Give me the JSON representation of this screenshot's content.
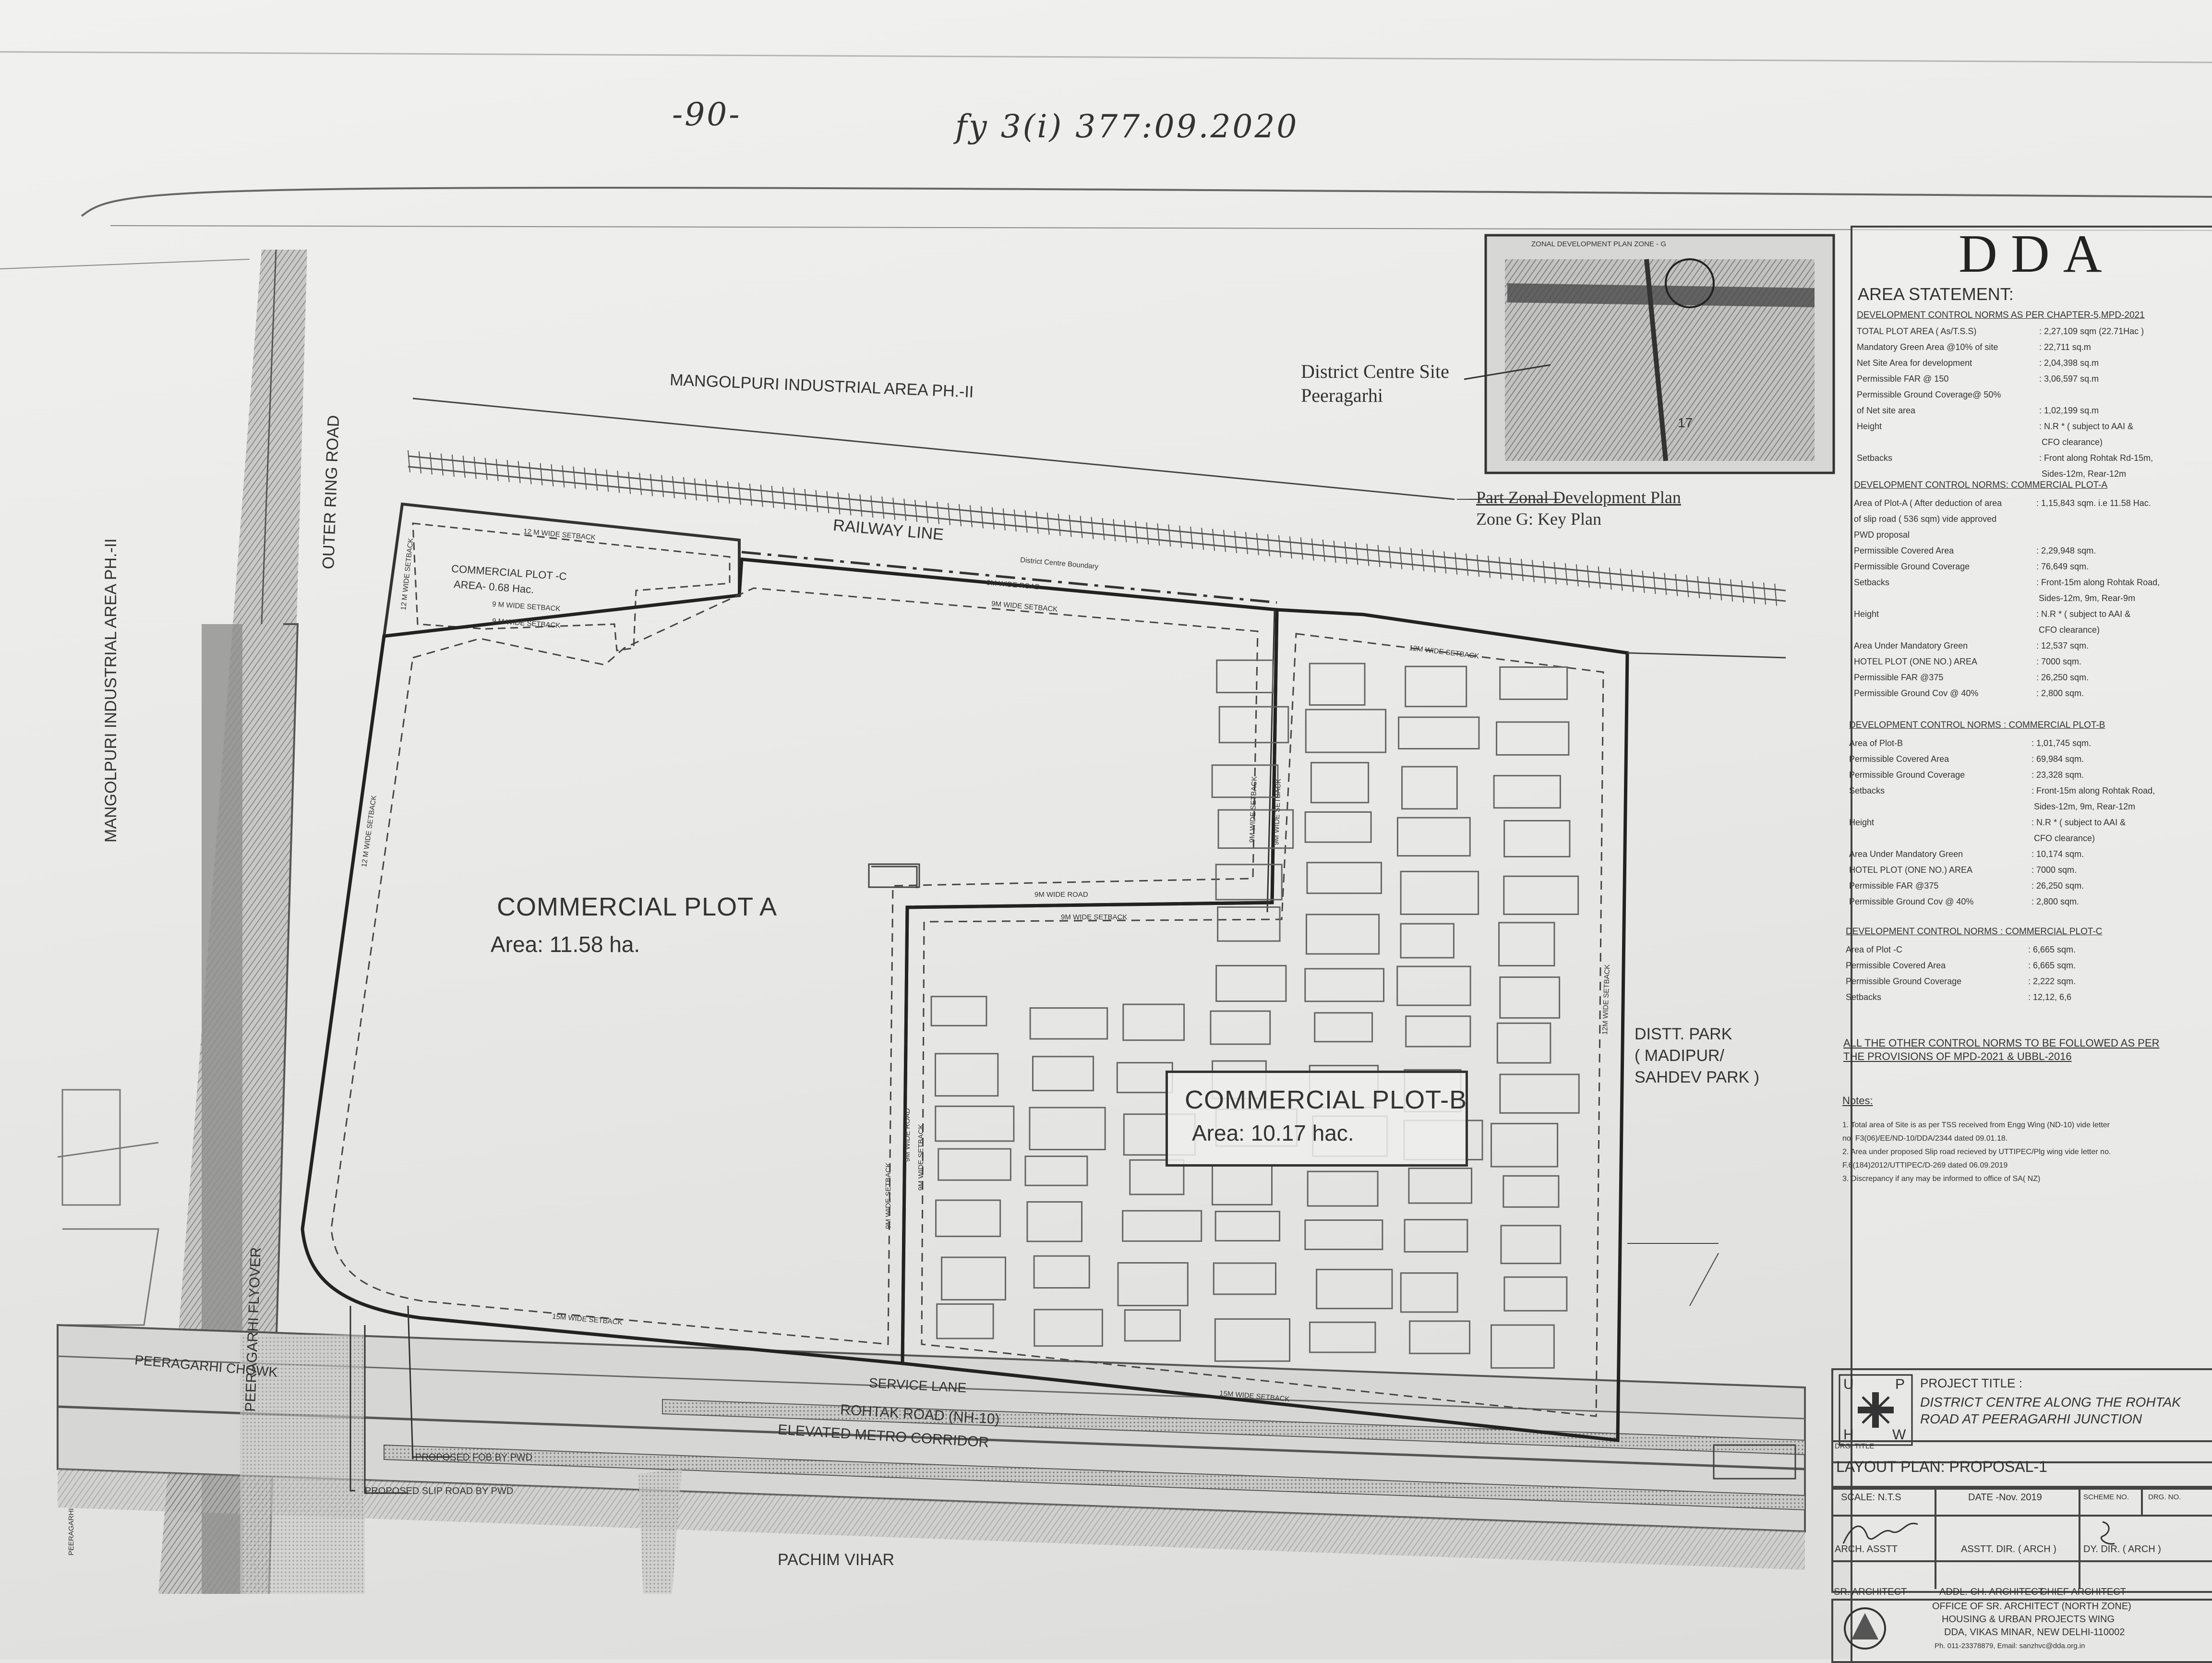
{
  "handwritten_header": {
    "page_mark": "-90-",
    "file_ref": "fy 3(i) 377:09.2020"
  },
  "keyplan": {
    "inset_title": "ZONAL DEVELOPMENT PLAN ZONE - G",
    "site_label_line1": "District Centre Site",
    "site_label_line2": "Peeragarhi",
    "caption_line1": "Part Zonal Development Plan",
    "caption_line2": "Zone G: Key Plan",
    "inset_number": "17"
  },
  "map_labels": {
    "mangolpuri_ph2": "MANGOLPURI INDUSTRIAL AREA PH.-II",
    "mangolpuri_vertical": "MANGOLPURI INDUSTRIAL AREA PH.-II",
    "outer_ring_road": "OUTER RING ROAD",
    "railway_line": "RAILWAY LINE",
    "dc_boundary": "District Centre Boundary",
    "road_9m": "9M WIDE ROAD",
    "peeragarhi_flyover": "PEERAGARHI FLYOVER",
    "peeragarhi_chowk": "PEERAGARHI CHOWK",
    "service_lane": "SERVICE LANE",
    "rohtak_road": "ROHTAK ROAD (NH-10)",
    "metro_corridor": "ELEVATED METRO CORRIDOR",
    "proposed_fob": "PROPOSED FOB BY PWD",
    "proposed_slip": "PROPOSED SLIP ROAD BY PWD",
    "pachim_vihar": "PACHIM VIHAR",
    "distt_park_1": "DISTT. PARK",
    "distt_park_2": "( MADIPUR/",
    "distt_park_3": "SAHDEV PARK )",
    "peeragarhi_small": "PEERAGARHI"
  },
  "setbacks": {
    "s12_top_c": "12 M WIDE SETBACK",
    "s12_left_c": "12 M WIDE SETBACK",
    "s9_c_a": "9 M WIDE SETBACK",
    "s9_c_b": "9 M WIDE SETBACK",
    "s9_top_a": "9M WIDE SETBACK",
    "s12_left_a": "12 M WIDE SETBACK",
    "s9_right_a": "9M WIDE SETBACK",
    "s9_mid_a": "9M WIDE SETBACK",
    "s9_road_b": "9M WIDE ROAD",
    "s9_top_b_inner": "9M WIDE SETBACK",
    "s12_top_b": "12M WIDE SETBACK",
    "s12_right_b": "12M WIDE SETBACK",
    "s15_a": "15M WIDE SETBACK",
    "s15_b": "15M WIDE SETBACK",
    "s9_left_b_1": "9M WIDE SETBACK",
    "s9_left_b_2": "9M WIDE SETBACK",
    "s9_left_b_3": "9M WIDE ROAD"
  },
  "plots": {
    "c_name": "COMMERCIAL PLOT -C",
    "c_area": "AREA- 0.68 Hac.",
    "a_name": "COMMERCIAL PLOT A",
    "a_area": "Area: 11.58 ha.",
    "b_name": "COMMERCIAL PLOT-B",
    "b_area": "Area: 10.17 hac."
  },
  "panel": {
    "logo": "DDA",
    "area_statement": "AREA STATEMENT:",
    "norms_heading": "DEVELOPMENT CONTROL NORMS AS PER CHAPTER-5,MPD-2021",
    "norms_rows": [
      [
        "TOTAL PLOT AREA ( As/T.S.S)",
        ": 2,27,109 sqm (22.71Hac )"
      ],
      [
        "Mandatory Green Area @10% of site",
        ": 22,711 sq.m"
      ],
      [
        "Net Site Area for development",
        ": 2,04,398 sq.m"
      ],
      [
        "Permissible FAR @ 150",
        ": 3,06,597 sq.m"
      ],
      [
        "Permissible Ground Coverage@ 50%",
        ""
      ],
      [
        "of Net site area",
        ": 1,02,199 sq.m"
      ],
      [
        "Height",
        ": N.R * ( subject to AAI &"
      ],
      [
        "",
        "  CFO clearance)"
      ],
      [
        "Setbacks",
        ": Front along Rohtak Rd-15m,"
      ],
      [
        "",
        "  Sides-12m, Rear-12m"
      ]
    ],
    "plot_a_heading": "DEVELOPMENT CONTROL NORMS: COMMERCIAL PLOT-A",
    "plot_a_rows": [
      [
        "Area of Plot-A ( After deduction of area",
        ": 1,15,843 sqm. i.e 11.58 Hac."
      ],
      [
        "of slip road ( 536 sqm) vide approved",
        ""
      ],
      [
        "PWD proposal",
        ""
      ],
      [
        "Permissible Covered Area",
        ": 2,29,948 sqm."
      ],
      [
        "Permissible Ground Coverage",
        ": 76,649 sqm."
      ],
      [
        "Setbacks",
        ": Front-15m along Rohtak Road,"
      ],
      [
        "",
        "  Sides-12m, 9m, Rear-9m"
      ],
      [
        "Height",
        ": N.R * ( subject to AAI &"
      ],
      [
        "",
        "  CFO clearance)"
      ],
      [
        "Area Under Mandatory Green",
        ": 12,537 sqm."
      ],
      [
        "HOTEL PLOT (ONE NO.) AREA",
        ": 7000 sqm."
      ],
      [
        "Permissible FAR @375",
        ": 26,250 sqm."
      ],
      [
        "Permissible Ground Cov @ 40%",
        ": 2,800 sqm."
      ]
    ],
    "plot_b_heading": "DEVELOPMENT CONTROL NORMS : COMMERCIAL PLOT-B",
    "plot_b_rows": [
      [
        "Area of Plot-B",
        ": 1,01,745 sqm."
      ],
      [
        "Permissible Covered Area",
        ": 69,984 sqm."
      ],
      [
        "Permissible Ground Coverage",
        ": 23,328 sqm."
      ],
      [
        "Setbacks",
        ": Front-15m along Rohtak Road,"
      ],
      [
        "",
        "  Sides-12m, 9m, Rear-12m"
      ],
      [
        "Height",
        ": N.R * ( subject to AAI &"
      ],
      [
        "",
        "  CFO clearance)"
      ],
      [
        "Area Under Mandatory Green",
        ": 10,174 sqm."
      ],
      [
        "HOTEL PLOT (ONE NO.) AREA",
        ": 7000 sqm."
      ],
      [
        "Permissible FAR @375",
        ": 26,250 sqm."
      ],
      [
        "Permissible Ground Cov @ 40%",
        ": 2,800 sqm."
      ]
    ],
    "plot_c_heading": "DEVELOPMENT CONTROL NORMS : COMMERCIAL PLOT-C",
    "plot_c_rows": [
      [
        "Area of Plot -C",
        ": 6,665 sqm."
      ],
      [
        "Permissible Covered Area",
        ": 6,665 sqm."
      ],
      [
        "Permissible Ground Coverage",
        ": 2,222 sqm."
      ],
      [
        "Setbacks",
        ": 12,12, 6,6"
      ]
    ],
    "other_norms_1": "ALL THE OTHER CONTROL NORMS TO BE FOLLOWED AS PER",
    "other_norms_2": "THE PROVISIONS OF MPD-2021 & UBBL-2016",
    "notes_heading": "Notes:",
    "notes": [
      "1.  Total area of Site is as per TSS received from Engg Wing (ND-10) vide letter",
      "     no. F3(06)/EE/ND-10/DDA/2344 dated 09.01.18.",
      "2.  Area under proposed Slip road recieved by UTTIPEC/Plg wing vide letter no.",
      "     F.6(184)2012/UTTIPEC/D-269 dated 06.09.2019",
      "3.  Discrepancy if any may be informed to office of SA( NZ)"
    ],
    "uphw": [
      "U",
      "P",
      "H",
      "W"
    ],
    "project_title_label": "PROJECT TITLE :",
    "project_title_1": "DISTRICT CENTRE ALONG THE ROHTAK",
    "project_title_2": "ROAD AT PEERAGARHI JUNCTION",
    "drg_title_label": "DRG. TITLE",
    "drg_title": "LAYOUT PLAN: PROPOSAL-1",
    "scale": "SCALE: N.T.S",
    "date": "DATE -Nov. 2019",
    "scheme_no": "SCHEME NO.",
    "drg_no": "DRG. NO.",
    "arch_asstt": "ARCH. ASSTT",
    "asstt_dir": "ASSTT. DIR. ( ARCH )",
    "dy_dir": "DY. DIR. ( ARCH )",
    "sr_architect": "SR. ARCHITECT",
    "addl_ch": "ADDL. CH. ARCHITECT",
    "chief_arch": "CHIEF ARCHITECT",
    "office_1": "OFFICE OF SR. ARCHITECT (NORTH ZONE)",
    "office_2": "HOUSING & URBAN PROJECTS WING",
    "office_3": "DDA, VIKAS MINAR, NEW DELHI-110002",
    "office_4": "Ph. 011-23378879,  Email: sanzhvc@dda.org.in"
  },
  "colors": {
    "paper": "#e9e9e7",
    "ink": "#2a2a2a",
    "hatch": "#6e6e6e"
  }
}
